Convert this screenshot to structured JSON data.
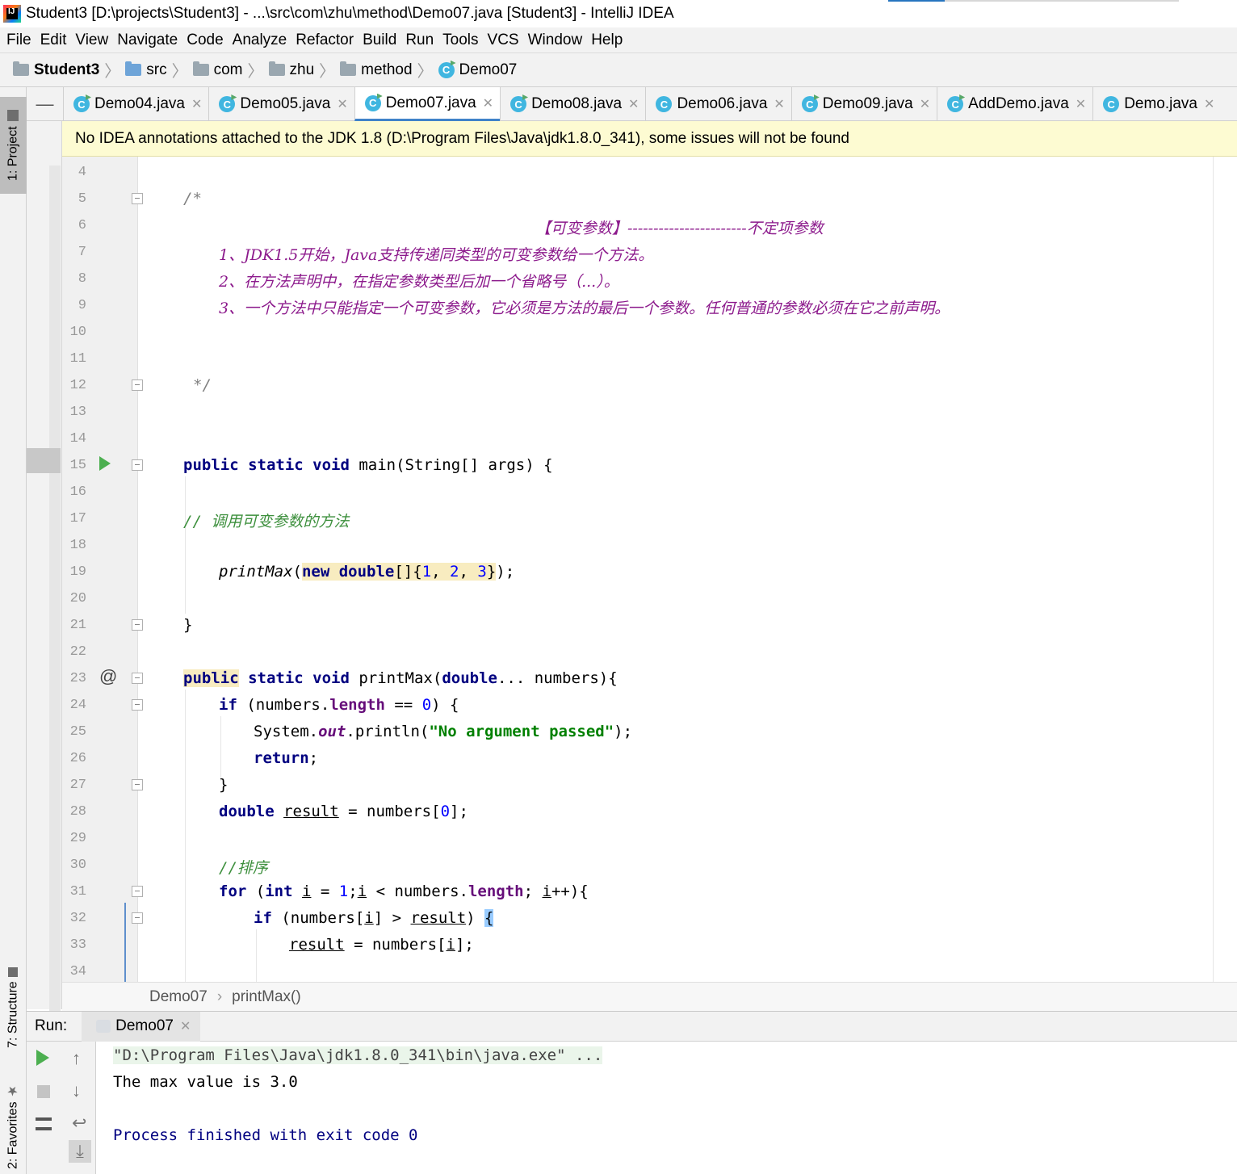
{
  "window": {
    "title": "Student3 [D:\\projects\\Student3] - ...\\src\\com\\zhu\\method\\Demo07.java [Student3] - IntelliJ IDEA",
    "app_icon": "IJ"
  },
  "menu": [
    "File",
    "Edit",
    "View",
    "Navigate",
    "Code",
    "Analyze",
    "Refactor",
    "Build",
    "Run",
    "Tools",
    "VCS",
    "Window",
    "Help"
  ],
  "breadcrumb": {
    "project": "Student3",
    "folders": [
      "src",
      "com",
      "zhu",
      "method"
    ],
    "file": "Demo07"
  },
  "side_tools": {
    "project": "1: Project",
    "structure": "7: Structure",
    "favorites": "2: Favorites"
  },
  "tabs": [
    {
      "label": "Demo04.java",
      "active": false
    },
    {
      "label": "Demo05.java",
      "active": false
    },
    {
      "label": "Demo07.java",
      "active": true
    },
    {
      "label": "Demo08.java",
      "active": false
    },
    {
      "label": "Demo06.java",
      "active": false
    },
    {
      "label": "Demo09.java",
      "active": false
    },
    {
      "label": "AddDemo.java",
      "active": false
    },
    {
      "label": "Demo.java",
      "active": false
    }
  ],
  "banner": "No IDEA annotations attached to the JDK 1.8 (D:\\Program Files\\Java\\jdk1.8.0_341), some issues will not be found",
  "editor": {
    "line_numbers": [
      "4",
      "5",
      "6",
      "7",
      "8",
      "9",
      "10",
      "11",
      "12",
      "13",
      "14",
      "15",
      "16",
      "17",
      "18",
      "19",
      "20",
      "21",
      "22",
      "23",
      "24",
      "25",
      "26",
      "27",
      "28",
      "29",
      "30",
      "31",
      "32",
      "33",
      "34"
    ],
    "code": {
      "l5": "/*",
      "l6": "【可变参数】-----------------------不定项参数",
      "l7": "1、JDK1.5开始，Java支持传递同类型的可变参数给一个方法。",
      "l8": "2、在方法声明中，在指定参数类型后加一个省略号（...）。",
      "l9": "3、一个方法中只能指定一个可变参数，它必须是方法的最后一个参数。任何普通的参数必须在它之前声明。",
      "l12": "*/",
      "l15_kw": "public static void",
      "l15_rest": " main(String[] args) {",
      "l17": "// 调用可变参数的方法",
      "l19_call": "printMax",
      "l19_open": "(",
      "l19_new": "new double",
      "l19_arr": "[]{",
      "l19_n1": "1",
      "l19_c1": ", ",
      "l19_n2": "2",
      "l19_c2": ", ",
      "l19_n3": "3",
      "l19_close": "}",
      "l19_end": ");",
      "l21": "}",
      "l23_pub": "public",
      "l23_kw": " static void",
      "l23_name": " printMax(",
      "l23_type": "double",
      "l23_rest": "... numbers){",
      "l24_if": "if",
      "l24_a": " (numbers.",
      "l24_len": "length",
      "l24_b": " == ",
      "l24_zero": "0",
      "l24_c": ") {",
      "l25_a": "System.",
      "l25_out": "out",
      "l25_b": ".println(",
      "l25_str": "\"No argument passed\"",
      "l25_c": ");",
      "l26": "return",
      "l26_semi": ";",
      "l27": "}",
      "l28_type": "double",
      "l28_sp": " ",
      "l28_var": "result",
      "l28_rest": " = numbers[",
      "l28_zero": "0",
      "l28_end": "];",
      "l30": "//排序",
      "l31_for": "for",
      "l31_a": " (",
      "l31_int": "int",
      "l31_sp": " ",
      "l31_i": "i",
      "l31_b": " = ",
      "l31_one": "1",
      "l31_c": ";",
      "l31_i2": "i",
      "l31_d": " < numbers.",
      "l31_len": "length",
      "l31_e": "; ",
      "l31_i3": "i",
      "l31_f": "++){",
      "l32_if": "if",
      "l32_a": " (numbers[",
      "l32_i": "i",
      "l32_b": "] > ",
      "l32_res": "result",
      "l32_c": ") ",
      "l32_brace": "{",
      "l33_res": "result",
      "l33_a": " = numbers[",
      "l33_i": "i",
      "l33_b": "];"
    }
  },
  "editor_breadcrumb": [
    "Demo07",
    "printMax()"
  ],
  "run": {
    "label": "Run:",
    "tab": "Demo07",
    "console": [
      "\"D:\\Program Files\\Java\\jdk1.8.0_341\\bin\\java.exe\" ...",
      "The max value is 3.0",
      "",
      "Process finished with exit code 0"
    ]
  },
  "colors": {
    "keyword": "#000080",
    "doc_comment": "#8c1a8c",
    "line_comment": "#808080",
    "string": "#008000",
    "number": "#0000ff",
    "banner_bg": "#fdfbd2",
    "active_tab_underline": "#4083c9"
  }
}
